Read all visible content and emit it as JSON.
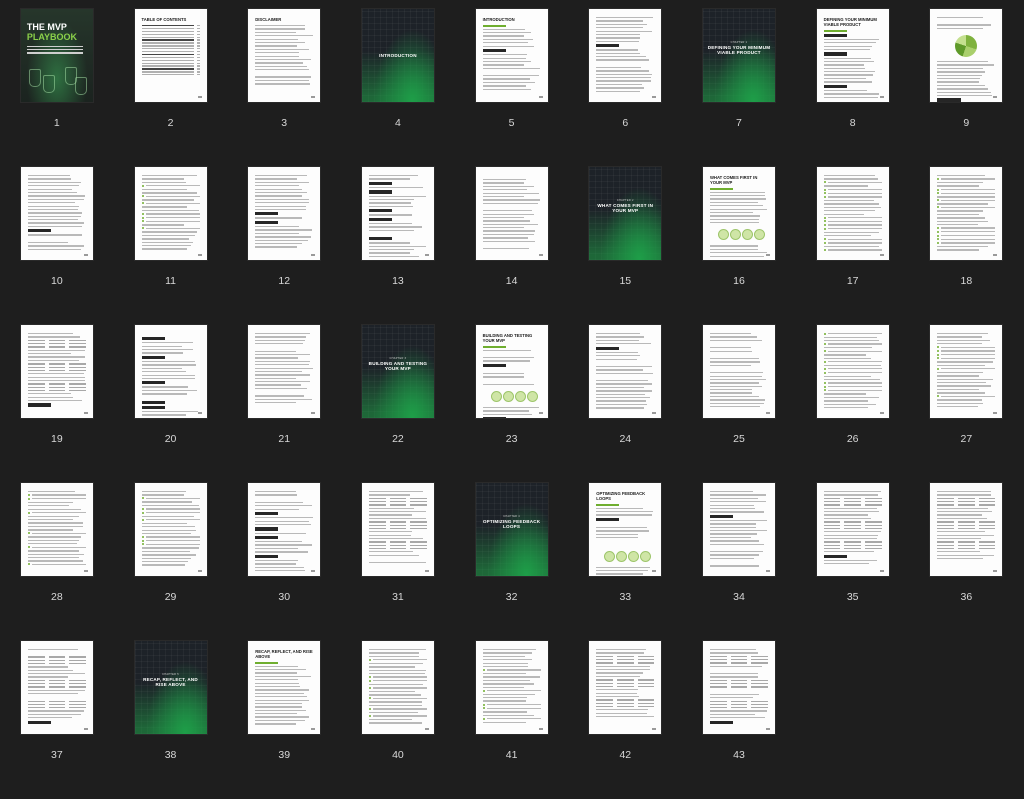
{
  "pages": [
    {
      "n": "1",
      "type": "cover",
      "title_line1": "THE MVP",
      "title_line2": "PLAYBOOK"
    },
    {
      "n": "2",
      "type": "text",
      "heading": "TABLE OF CONTENTS"
    },
    {
      "n": "3",
      "type": "text",
      "heading": "DISCLAIMER"
    },
    {
      "n": "4",
      "type": "dark",
      "chapter": "",
      "title": "INTRODUCTION"
    },
    {
      "n": "5",
      "type": "text",
      "heading": "INTRODUCTION"
    },
    {
      "n": "6",
      "type": "text",
      "heading": ""
    },
    {
      "n": "7",
      "type": "dark",
      "chapter": "CHAPTER 1",
      "title": "DEFINING YOUR MINIMUM VIABLE PRODUCT"
    },
    {
      "n": "8",
      "type": "text",
      "heading": "DEFINING YOUR MINIMUM VIABLE PRODUCT"
    },
    {
      "n": "9",
      "type": "text",
      "heading": ""
    },
    {
      "n": "10",
      "type": "text",
      "heading": ""
    },
    {
      "n": "11",
      "type": "text",
      "heading": ""
    },
    {
      "n": "12",
      "type": "text",
      "heading": ""
    },
    {
      "n": "13",
      "type": "text",
      "heading": ""
    },
    {
      "n": "14",
      "type": "text",
      "heading": ""
    },
    {
      "n": "15",
      "type": "dark",
      "chapter": "CHAPTER 2",
      "title": "WHAT COMES FIRST IN YOUR MVP"
    },
    {
      "n": "16",
      "type": "text",
      "heading": "WHAT COMES FIRST IN YOUR MVP"
    },
    {
      "n": "17",
      "type": "text",
      "heading": ""
    },
    {
      "n": "18",
      "type": "text",
      "heading": ""
    },
    {
      "n": "19",
      "type": "text",
      "heading": ""
    },
    {
      "n": "20",
      "type": "text",
      "heading": ""
    },
    {
      "n": "21",
      "type": "text",
      "heading": ""
    },
    {
      "n": "22",
      "type": "dark",
      "chapter": "CHAPTER 3",
      "title": "BUILDING AND TESTING YOUR MVP"
    },
    {
      "n": "23",
      "type": "text",
      "heading": "BUILDING AND TESTING YOUR MVP"
    },
    {
      "n": "24",
      "type": "text",
      "heading": ""
    },
    {
      "n": "25",
      "type": "text",
      "heading": ""
    },
    {
      "n": "26",
      "type": "text",
      "heading": ""
    },
    {
      "n": "27",
      "type": "text",
      "heading": ""
    },
    {
      "n": "28",
      "type": "text",
      "heading": ""
    },
    {
      "n": "29",
      "type": "text",
      "heading": ""
    },
    {
      "n": "30",
      "type": "text",
      "heading": ""
    },
    {
      "n": "31",
      "type": "text",
      "heading": ""
    },
    {
      "n": "32",
      "type": "dark",
      "chapter": "CHAPTER 4",
      "title": "OPTIMIZING FEEDBACK LOOPS"
    },
    {
      "n": "33",
      "type": "text",
      "heading": "OPTIMIZING FEEDBACK LOOPS"
    },
    {
      "n": "34",
      "type": "text",
      "heading": ""
    },
    {
      "n": "35",
      "type": "text",
      "heading": ""
    },
    {
      "n": "36",
      "type": "text",
      "heading": ""
    },
    {
      "n": "37",
      "type": "text",
      "heading": ""
    },
    {
      "n": "38",
      "type": "dark",
      "chapter": "CHAPTER 5",
      "title": "RECAP, REFLECT, AND RISE ABOVE"
    },
    {
      "n": "39",
      "type": "text",
      "heading": "RECAP, REFLECT, AND RISE ABOVE"
    },
    {
      "n": "40",
      "type": "text",
      "heading": ""
    },
    {
      "n": "41",
      "type": "text",
      "heading": ""
    },
    {
      "n": "42",
      "type": "text",
      "heading": ""
    },
    {
      "n": "43",
      "type": "text",
      "heading": ""
    }
  ],
  "colors": {
    "background": "#1e1e1e",
    "accent": "#6fae2f",
    "dark_page": "#1d2228"
  }
}
